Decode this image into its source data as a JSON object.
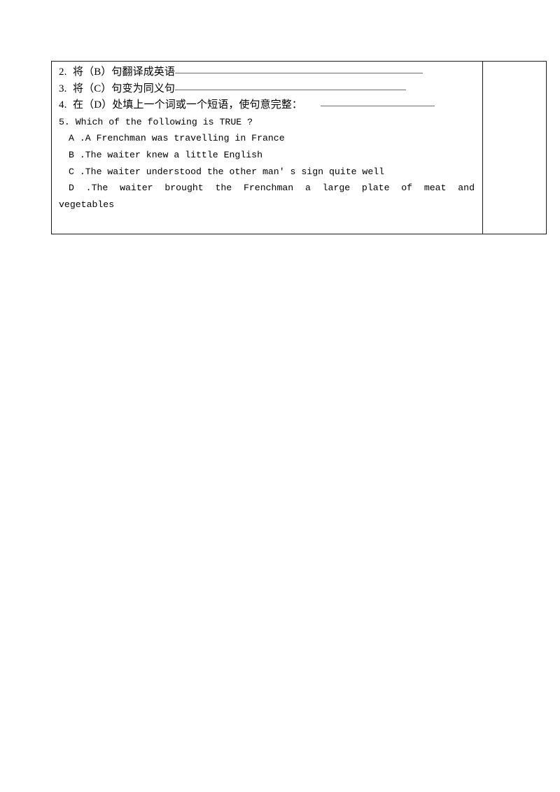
{
  "document": {
    "type": "exercise-worksheet",
    "background_color": "#ffffff",
    "text_color": "#000000",
    "border_color": "#1a1a1a",
    "rule_color": "#6d6d6d"
  },
  "table": {
    "columns": 2,
    "main_column_label": "questions",
    "side_column_label": "notes",
    "side_column_content": ""
  },
  "questions": [
    {
      "number": "2.",
      "text": "将（B）句翻译成英语",
      "has_blank": true,
      "blank_style": "rule-b"
    },
    {
      "number": "3.",
      "text": "将（C）句变为同义句",
      "has_blank": true,
      "blank_style": "rule-c"
    },
    {
      "number": "4.",
      "text": "在（D）处填上一个词或一个短语，使句意完整：",
      "has_blank": true,
      "blank_style": "rule-d"
    },
    {
      "number": "5.",
      "text": "Which of the following is TRUE ?",
      "has_blank": false
    }
  ],
  "options": [
    {
      "key": "A",
      "separator": " .",
      "text": "A Frenchman was travelling in France"
    },
    {
      "key": "B",
      "separator": " .",
      "text": "The waiter knew a little English"
    },
    {
      "key": "C",
      "separator": " .",
      "text": "The waiter understood the other man' s sign quite well"
    },
    {
      "key": "D",
      "separator": " .",
      "text": "The waiter brought the Frenchman a large plate of meat and",
      "continuation": "vegetables"
    }
  ],
  "line5_full": "5.  Which of the following is TRUE ?",
  "option_a_full": "A .A Frenchman was travelling in France",
  "option_b_full": "B .The waiter knew a little English",
  "option_c_full": "C .The waiter understood the other man' s sign quite well",
  "option_d_full": "D .The waiter brought the Frenchman a large plate of meat and",
  "option_d_continuation": "vegetables"
}
